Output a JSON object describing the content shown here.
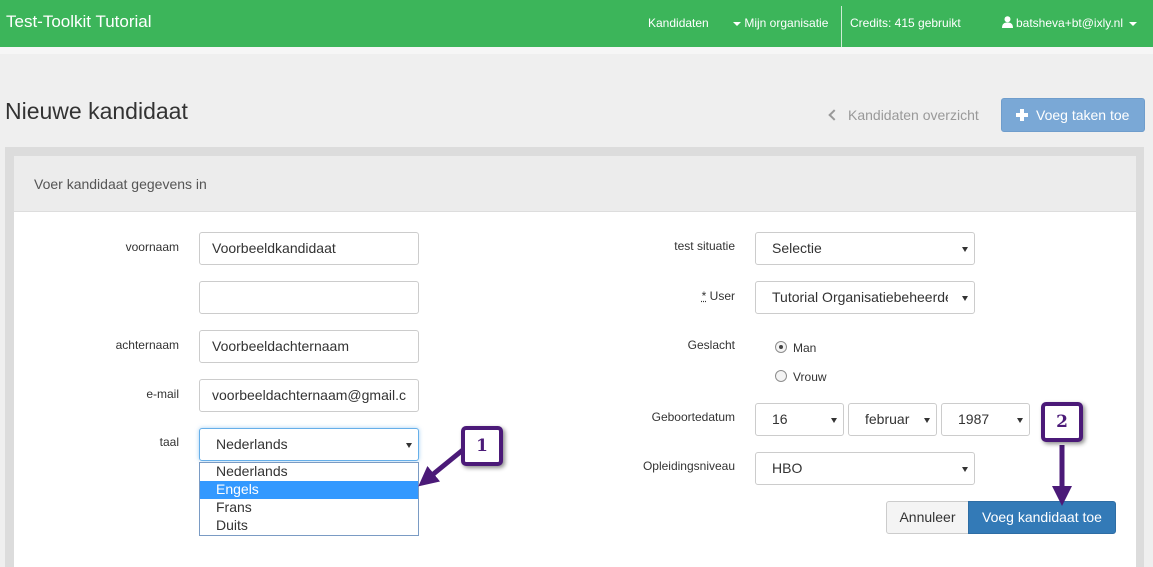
{
  "navbar": {
    "brand": "Test-Toolkit Tutorial",
    "kandidaten": "Kandidaten",
    "organisatie": "Mijn organisatie",
    "credits": "Credits: 415 gebruikt",
    "user": "batsheva+bt@ixly.nl"
  },
  "header": {
    "title": "Nieuwe kandidaat",
    "back_link": "Kandidaten overzicht",
    "add_tasks": "Voeg taken toe"
  },
  "panel": {
    "heading": "Voer kandidaat gegevens in"
  },
  "form": {
    "voornaam_label": "voornaam",
    "voornaam_value": "Voorbeeldkandidaat",
    "tussenvoegsel_value": "",
    "achternaam_label": "achternaam",
    "achternaam_value": "Voorbeeldachternaam",
    "email_label": "e-mail",
    "email_value": "voorbeeldachternaam@gmail.c",
    "taal_label": "taal",
    "taal_value": "Nederlands",
    "taal_options": [
      "Nederlands",
      "Engels",
      "Frans",
      "Duits"
    ],
    "taal_highlighted": "Engels",
    "test_situatie_label": "test situatie",
    "test_situatie_value": "Selectie",
    "user_required": "*",
    "user_label": "User",
    "user_value": "Tutorial Organisatiebeheerder",
    "geslacht_label": "Geslacht",
    "geslacht_options": [
      "Man",
      "Vrouw"
    ],
    "geslacht_selected": "Man",
    "geboortedatum_label": "Geboortedatum",
    "dag_value": "16",
    "maand_value": "februari",
    "jaar_value": "1987",
    "opleiding_label": "Opleidingsniveau",
    "opleiding_value": "HBO"
  },
  "buttons": {
    "annuleer": "Annuleer",
    "voeg_kandidaat": "Voeg kandidaat toe"
  },
  "annotations": {
    "step1": "1",
    "step2": "2",
    "color": "#4b1a78"
  },
  "colors": {
    "navbar": "#3cb55a",
    "primary": "#337ab7",
    "highlight": "#3399ff"
  }
}
